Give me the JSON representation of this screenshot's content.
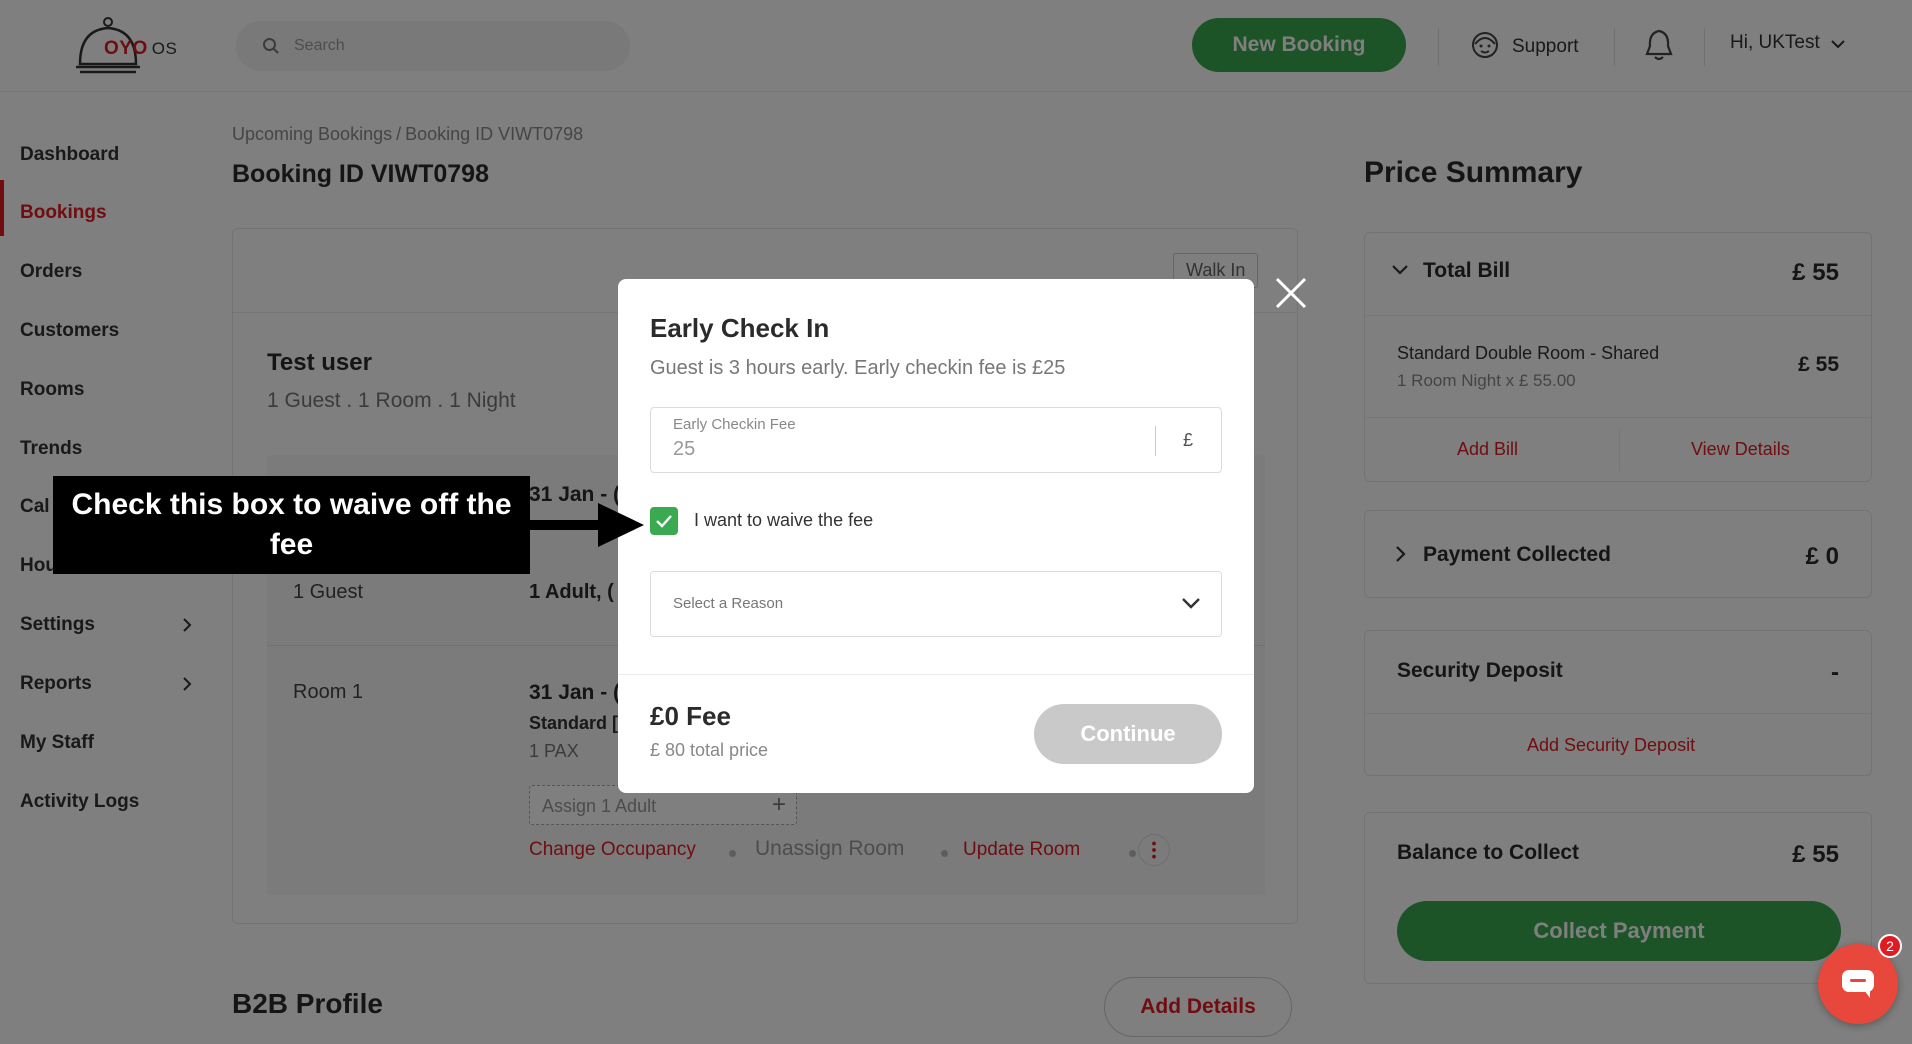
{
  "header": {
    "logo_text": "OYO",
    "logo_suffix": "OS",
    "search_placeholder": "Search",
    "new_booking_label": "New Booking",
    "support_label": "Support",
    "user_label": "Hi, UKTest"
  },
  "sidebar": {
    "items": [
      {
        "label": "Dashboard"
      },
      {
        "label": "Bookings"
      },
      {
        "label": "Orders"
      },
      {
        "label": "Customers"
      },
      {
        "label": "Rooms"
      },
      {
        "label": "Trends"
      },
      {
        "label": "Cal"
      },
      {
        "label": "Hou"
      },
      {
        "label": "Settings"
      },
      {
        "label": "Reports"
      },
      {
        "label": "My Staff"
      },
      {
        "label": "Activity Logs"
      }
    ],
    "active_index": 1
  },
  "main": {
    "breadcrumb": {
      "parent": "Upcoming Bookings",
      "separator": "/",
      "current": "Booking ID VIWT0798"
    },
    "title": "Booking ID VIWT0798",
    "walk_in_badge": "Walk In",
    "guest_name": "Test user",
    "guest_summary": "1 Guest . 1 Room . 1 Night",
    "stay_date": "31 Jan - (",
    "guests_label": "1 Guest",
    "guests_value": "1 Adult, (",
    "room_label": "Room 1",
    "room_date": "31 Jan - (",
    "room_type": "Standard [",
    "room_pax": "1 PAX",
    "assign_label": "Assign 1 Adult",
    "actions": {
      "change_occupancy": "Change Occupancy",
      "unassign_room": "Unassign Room",
      "update_room": "Update Room"
    },
    "b2b_title": "B2B Profile",
    "add_details_label": "Add Details"
  },
  "price_summary": {
    "title": "Price Summary",
    "total_bill_label": "Total Bill",
    "total_bill_amount": "£ 55",
    "line_item_name": "Standard Double Room - Shared",
    "line_item_detail": "1 Room Night x £ 55.00",
    "line_item_amount": "£ 55",
    "add_bill_label": "Add Bill",
    "view_details_label": "View Details",
    "payment_collected_label": "Payment Collected",
    "payment_collected_amount": "£ 0",
    "security_deposit_label": "Security Deposit",
    "security_deposit_amount": "-",
    "add_security_deposit_label": "Add Security Deposit",
    "balance_label": "Balance to Collect",
    "balance_amount": "£ 55",
    "collect_payment_label": "Collect Payment"
  },
  "modal": {
    "title": "Early Check In",
    "subtitle": "Guest is 3 hours early. Early checkin fee is £25",
    "fee_field_label": "Early Checkin Fee",
    "fee_field_value": "25",
    "fee_currency": "£",
    "waive_checked": true,
    "waive_label": "I want to waive the fee",
    "reason_placeholder": "Select a Reason",
    "fee_summary": "£0 Fee",
    "total_price": "£ 80 total price",
    "continue_label": "Continue"
  },
  "annotation": {
    "callout_text": "Check this box to waive off the fee"
  },
  "chat_widget": {
    "badge_count": "2"
  },
  "colors": {
    "brand_red": "#e11b22",
    "brand_green": "#3aa94f",
    "overlay": "rgba(0,0,0,0.5)"
  },
  "icons": [
    "search-icon",
    "support-icon",
    "bell-icon",
    "chevron-down-icon",
    "chevron-right-icon",
    "close-icon",
    "check-icon",
    "plus-icon",
    "kebab-icon",
    "chat-icon"
  ]
}
